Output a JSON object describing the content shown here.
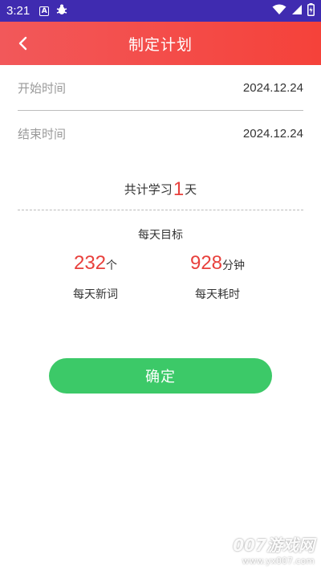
{
  "status_bar": {
    "time": "3:21",
    "icons": [
      "a-icon",
      "bug-icon",
      "wifi-icon",
      "signal-icon",
      "battery-icon"
    ]
  },
  "app_bar": {
    "title": "制定计划",
    "back_icon": "chevron-left-icon"
  },
  "form": {
    "start_label": "开始时间",
    "start_value": "2024.12.24",
    "end_label": "结束时间",
    "end_value": "2024.12.24"
  },
  "total": {
    "prefix": "共计学习",
    "days": "1",
    "suffix": "天"
  },
  "daily_goal": {
    "title": "每天目标",
    "new_words": {
      "value": "232",
      "unit": "个",
      "caption": "每天新词"
    },
    "time_spent": {
      "value": "928",
      "unit": "分钟",
      "caption": "每天耗时"
    }
  },
  "confirm_label": "确定",
  "watermark": {
    "line1": "007游戏网",
    "line2": "www.yx007.com"
  },
  "colors": {
    "status_bar": "#3f2bb0",
    "header": "#f5423a",
    "accent_red": "#e8403c",
    "button_green": "#3cc968"
  }
}
